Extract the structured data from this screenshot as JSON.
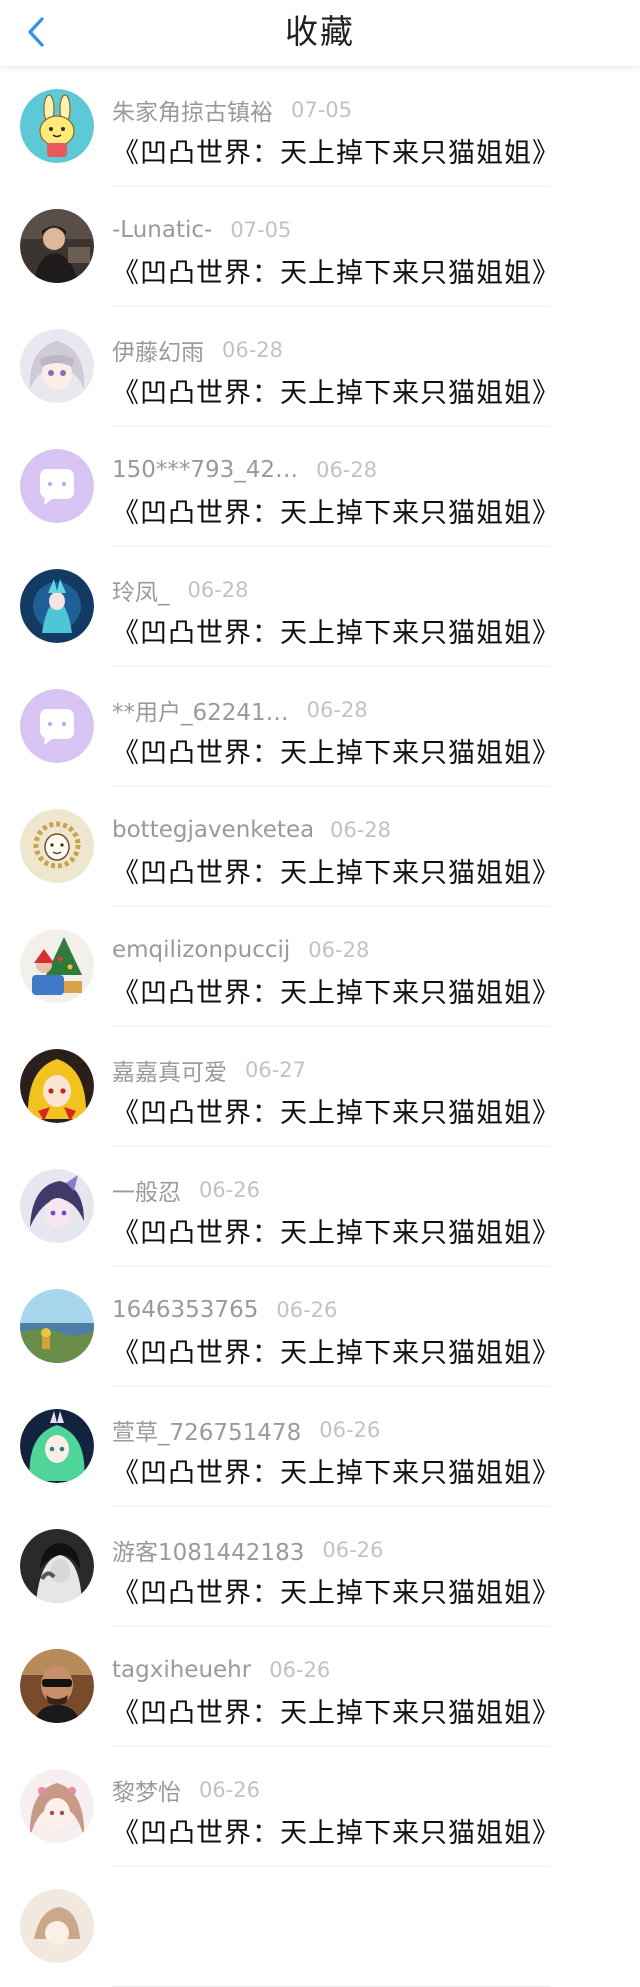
{
  "header": {
    "title": "收藏",
    "accent_color": "#3a8ee6"
  },
  "items": [
    {
      "username": "朱家角掠古镇裕",
      "date": "07-05",
      "title": "《凹凸世界：天上掉下来只猫姐姐》",
      "avatar": "bunny-avatar-icon"
    },
    {
      "username": "-Lunatic-",
      "date": "07-05",
      "title": "《凹凸世界：天上掉下来只猫姐姐》",
      "avatar": "photo-person-avatar-icon"
    },
    {
      "username": "伊藤幻雨",
      "date": "06-28",
      "title": "《凹凸世界：天上掉下来只猫姐姐》",
      "avatar": "anime-silver-hair-avatar-icon"
    },
    {
      "username": "150***793_42…",
      "date": "06-28",
      "title": "《凹凸世界：天上掉下来只猫姐姐》",
      "avatar": "default-chat-bubble-avatar-icon"
    },
    {
      "username": "玲凤_",
      "date": "06-28",
      "title": "《凹凸世界：天上掉下来只猫姐姐》",
      "avatar": "anime-blue-night-avatar-icon"
    },
    {
      "username": "**用户_62241…",
      "date": "06-28",
      "title": "《凹凸世界：天上掉下来只猫姐姐》",
      "avatar": "default-chat-bubble-avatar-icon"
    },
    {
      "username": "bottegjavenketea",
      "date": "06-28",
      "title": "《凹凸世界：天上掉下来只猫姐姐》",
      "avatar": "sketch-lion-avatar-icon"
    },
    {
      "username": "emqilizonpuccij",
      "date": "06-28",
      "title": "《凹凸世界：天上掉下来只猫姐姐》",
      "avatar": "christmas-photo-avatar-icon"
    },
    {
      "username": "嘉嘉真可爱",
      "date": "06-27",
      "title": "《凹凸世界：天上掉下来只猫姐姐》",
      "avatar": "anime-yellow-avatar-icon"
    },
    {
      "username": "一般忍",
      "date": "06-26",
      "title": "《凹凸世界：天上掉下来只猫姐姐》",
      "avatar": "anime-purple-avatar-icon"
    },
    {
      "username": "1646353765",
      "date": "06-26",
      "title": "《凹凸世界：天上掉下来只猫姐姐》",
      "avatar": "landscape-photo-avatar-icon"
    },
    {
      "username": "萱草_726751478",
      "date": "06-26",
      "title": "《凹凸世界：天上掉下来只猫姐姐》",
      "avatar": "anime-green-hair-avatar-icon"
    },
    {
      "username": "游客1081442183",
      "date": "06-26",
      "title": "《凹凸世界：天上掉下来只猫姐姐》",
      "avatar": "monochrome-portrait-avatar-icon"
    },
    {
      "username": "tagxiheuehr",
      "date": "06-26",
      "title": "《凹凸世界：天上掉下来只猫姐姐》",
      "avatar": "sunglasses-man-avatar-icon"
    },
    {
      "username": "黎梦怡",
      "date": "06-26",
      "title": "《凹凸世界：天上掉下来只猫姐姐》",
      "avatar": "anime-pink-girl-avatar-icon"
    },
    {
      "username": "",
      "date": "",
      "title": "",
      "avatar": "anime-partial-avatar-icon"
    }
  ]
}
